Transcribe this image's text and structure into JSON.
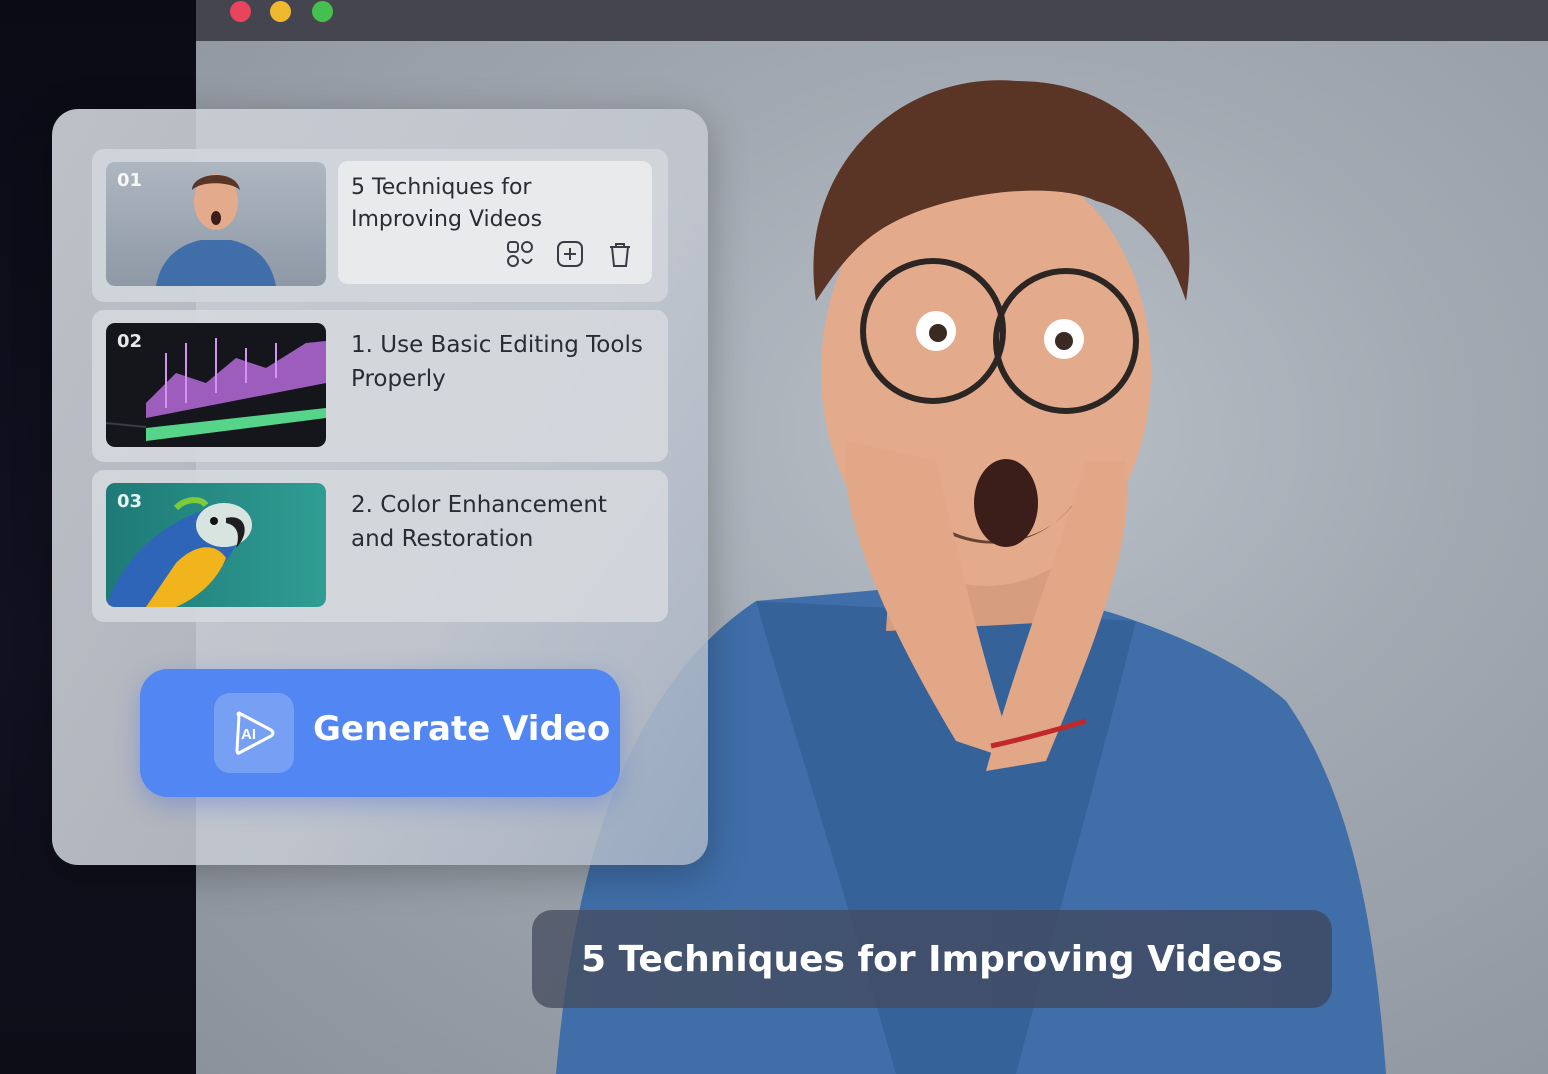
{
  "window": {
    "colors": {
      "close": "#e9435d",
      "minimize": "#f0b92d",
      "maximize": "#43c04d"
    }
  },
  "scene_list": {
    "items": [
      {
        "number": "01",
        "title": "5 Techniques for Improving Videos",
        "thumbnail": "surprised-man"
      },
      {
        "number": "02",
        "title": "1. Use Basic Editing Tools Properly",
        "thumbnail": "editing-timeline"
      },
      {
        "number": "03",
        "title": "2. Color Enhancement and Restoration",
        "thumbnail": "parrot"
      }
    ],
    "actions": [
      "replace-media-icon",
      "add-icon",
      "trash-icon"
    ]
  },
  "generate_button": {
    "label": "Generate Video",
    "icon": "ai-play-icon",
    "color": "#5186f3"
  },
  "preview": {
    "caption": "5 Techniques for Improving Videos"
  }
}
